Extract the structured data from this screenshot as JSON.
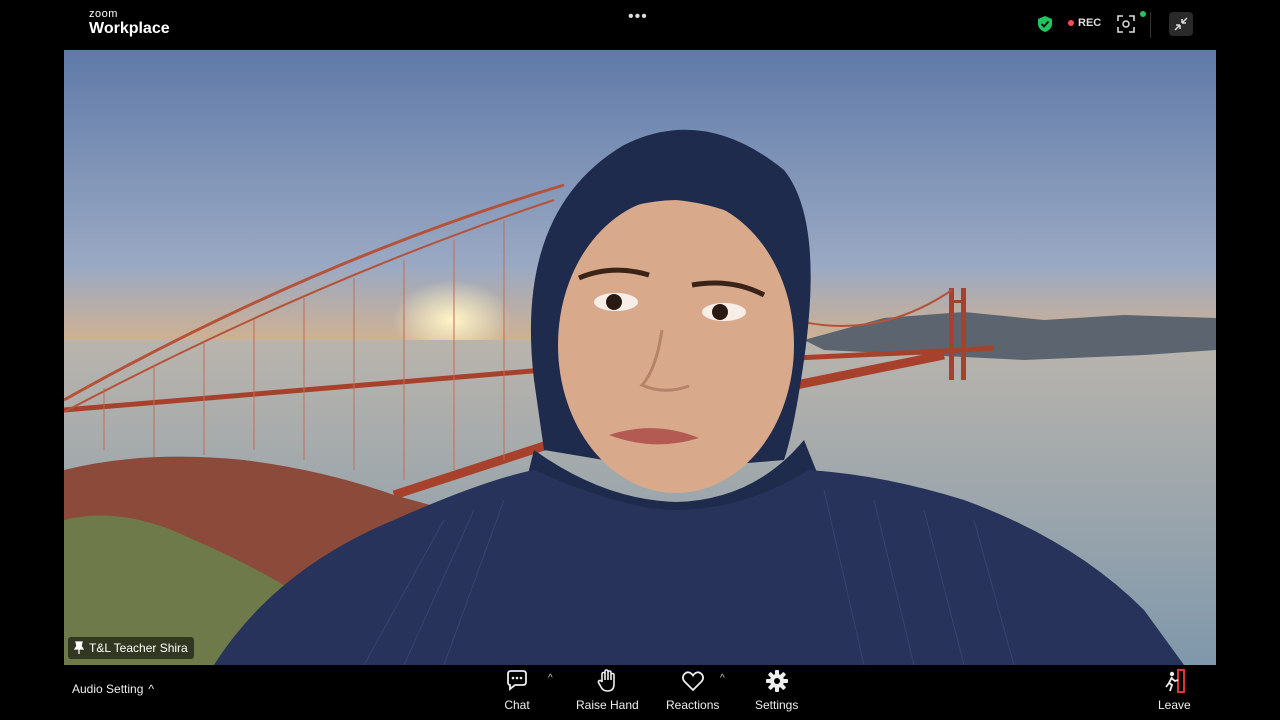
{
  "app": {
    "logo_small": "zoom",
    "logo_big": "Workplace",
    "more_glyph": "•••",
    "rec_label": "REC"
  },
  "icons": {
    "shield": "shield-check-icon",
    "focus": "focus-frame-icon",
    "shrink": "exit-fullscreen-icon"
  },
  "colors": {
    "shield": "#22c55e",
    "rec_dot": "#ff4d4d",
    "leave_accent": "#e0333a"
  },
  "participant": {
    "name": "T&L Teacher Shira"
  },
  "toolbar": {
    "audio_setting": "Audio Setting",
    "chat": "Chat",
    "raise_hand": "Raise Hand",
    "reactions": "Reactions",
    "settings": "Settings",
    "leave": "Leave",
    "caret": "^"
  }
}
